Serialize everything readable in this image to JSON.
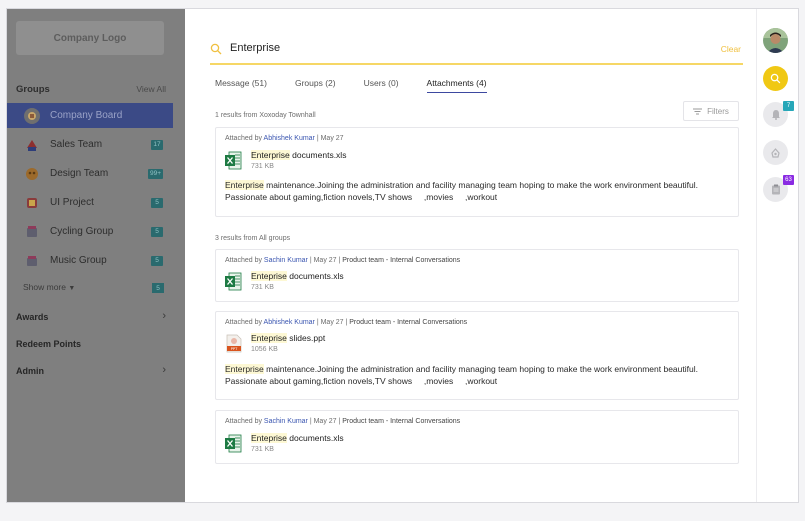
{
  "sidebar": {
    "logo": "Company Logo",
    "groups_title": "Groups",
    "view_all": "View All",
    "items": [
      {
        "label": "Company Board",
        "badge": ""
      },
      {
        "label": "Sales Team",
        "badge": "17"
      },
      {
        "label": "Design Team",
        "badge": "99+"
      },
      {
        "label": "UI Project",
        "badge": "5"
      },
      {
        "label": "Cycling Group",
        "badge": "5"
      },
      {
        "label": "Music Group",
        "badge": "5"
      }
    ],
    "show_more": "Show more",
    "show_more_badge": "5",
    "nav": [
      {
        "label": "Awards",
        "chevron": "›"
      },
      {
        "label": "Redeem Points",
        "chevron": ""
      },
      {
        "label": "Admin",
        "chevron": "›"
      }
    ]
  },
  "search": {
    "query": "Enterprise",
    "clear_label": "Clear"
  },
  "tabs": [
    {
      "label": "Message (51)"
    },
    {
      "label": "Groups (2)"
    },
    {
      "label": "Users (0)"
    },
    {
      "label": "Attachments (4)"
    }
  ],
  "filters_label": "Filters",
  "sections": [
    {
      "label": "1 results from Xoxoday Townhall"
    },
    {
      "label": "3 results from All groups"
    }
  ],
  "results": [
    {
      "prefix": "Attached by ",
      "author": "Abhishek Kumar",
      "meta": " | May 27",
      "context": "",
      "file_highlight": "Enterprise",
      "file_rest": " documents.xls",
      "size": "731 KB",
      "file_type": "excel-icon",
      "snippet_highlight": "Enterprise",
      "snippet_line1": " maintenance.Joining the administration and facility managing team hoping to make the work environment beautiful.",
      "snippet_line2": "Passionate about gaming,fiction novels,TV shows     ,movies     ,workout"
    },
    {
      "prefix": "Attached by ",
      "author": "Sachin Kumar",
      "meta": " | May 27 | ",
      "context": "Product team - Internal Conversations",
      "file_highlight": "Enteprise",
      "file_rest": " documents.xls",
      "size": "731 KB",
      "file_type": "excel-icon"
    },
    {
      "prefix": "Attached by ",
      "author": "Abhishek Kumar",
      "meta": " | May 27 | ",
      "context": "Product team - Internal Conversations",
      "file_highlight": "Enteprise",
      "file_rest": " slides.ppt",
      "size": "1056 KB",
      "file_type": "ppt-icon",
      "snippet_highlight": "Enterprise",
      "snippet_line1": " maintenance.Joining the administration and facility managing team hoping to make the work environment beautiful.",
      "snippet_line2": "Passionate about gaming,fiction novels,TV shows     ,movies     ,workout"
    },
    {
      "prefix": "Attached by ",
      "author": "Sachin Kumar",
      "meta": " | May 27 | ",
      "context": "Product team - Internal Conversations",
      "file_highlight": "Enteprise",
      "file_rest": " documents.xls",
      "size": "731 KB",
      "file_type": "excel-icon"
    }
  ],
  "rail": {
    "notifications_badge": "7",
    "tasks_badge": "63"
  },
  "colors": {
    "accent_yellow": "#f0c814",
    "active_tab": "#3d49a0",
    "link_blue": "#3a55b0",
    "badge_teal": "#2a6a6e"
  }
}
